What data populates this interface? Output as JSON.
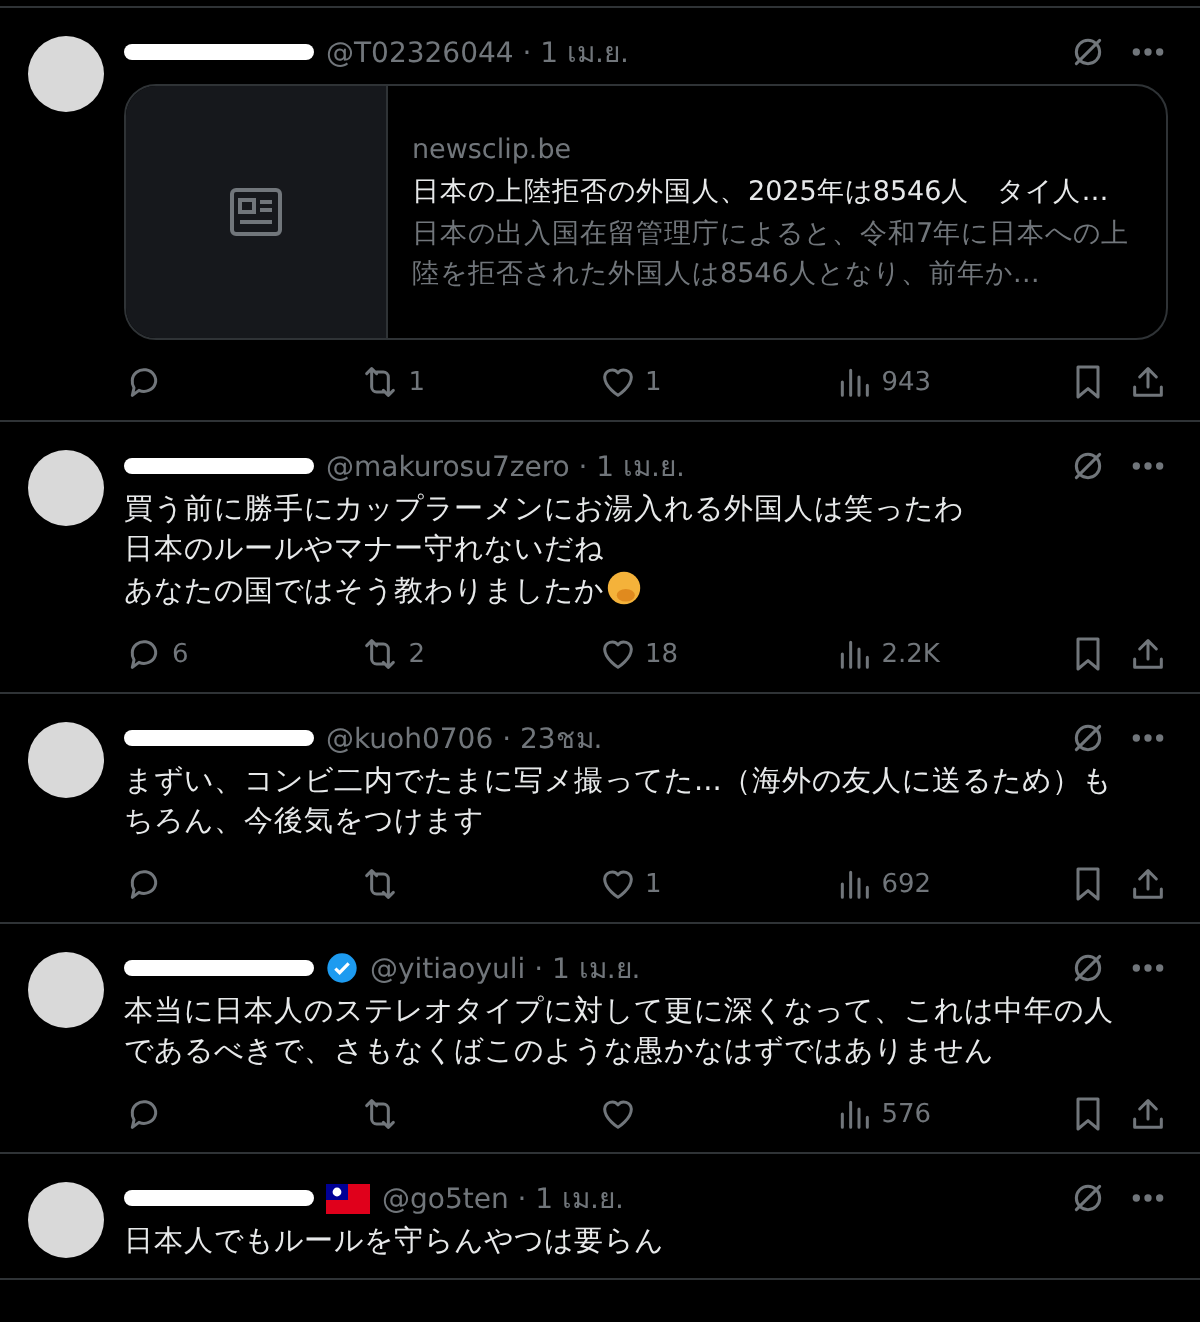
{
  "tweets": [
    {
      "meta": "@T02326044 · 1 เม.ย.",
      "verified": false,
      "flag": false,
      "emoji": false,
      "card": {
        "domain": "newsclip.be",
        "title": "日本の上陸拒否の外国人、2025年は8546人　タイ人…",
        "description": "日本の出入国在留管理庁によると、令和7年に日本への上陸を拒否された外国人は8546人となり、前年か…"
      },
      "actions": {
        "reposts": "1",
        "likes": "1",
        "views": "943"
      }
    },
    {
      "meta": "@makurosu7zero · 1 เม.ย.",
      "verified": false,
      "flag": false,
      "emoji": true,
      "lines": [
        "買う前に勝手にカップラーメンにお湯入れる外国人は笑ったわ",
        "日本のルールやマナー守れないだね",
        "あなたの国ではそう教わりましたか"
      ],
      "actions": {
        "replies": "6",
        "reposts": "2",
        "likes": "18",
        "views": "2.2K"
      }
    },
    {
      "meta": "@kuoh0706 · 23ชม.",
      "verified": false,
      "flag": false,
      "emoji": false,
      "text": "まずい、コンビ二内でたまに写メ撮ってた...（海外の友人に送るため）もちろん、今後気をつけます",
      "actions": {
        "likes": "1",
        "views": "692"
      }
    },
    {
      "meta": "@yitiaoyuli · 1 เม.ย.",
      "verified": true,
      "flag": false,
      "emoji": false,
      "text": "本当に日本人のステレオタイプに対して更に深くなって、これは中年の人であるべきで、さもなくばこのような愚かなはずではありません",
      "actions": {
        "views": "576"
      }
    },
    {
      "meta": "@go5ten · 1 เม.ย.",
      "verified": false,
      "flag": true,
      "emoji": false,
      "text": "日本人でもルールを守らんやつは要らん"
    }
  ]
}
